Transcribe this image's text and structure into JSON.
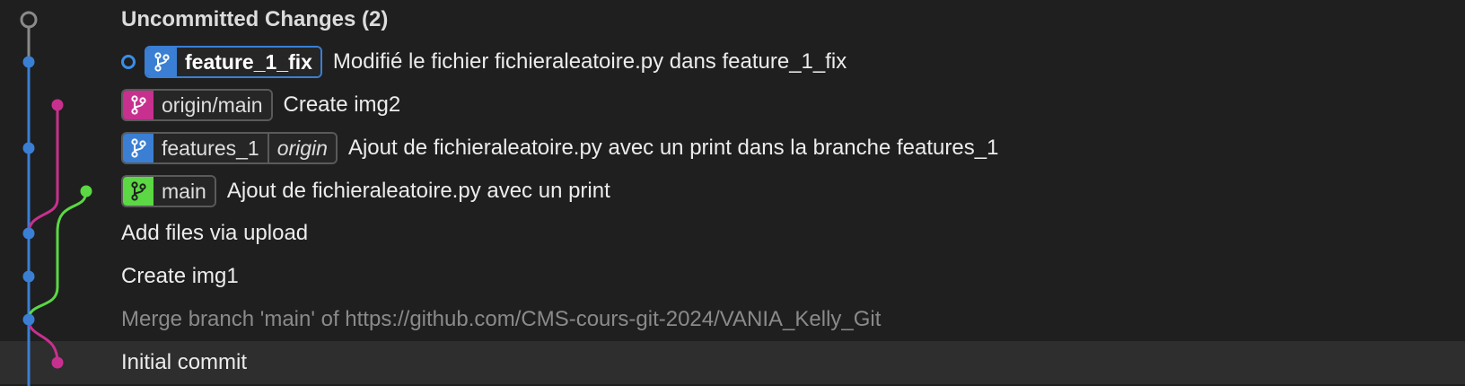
{
  "colors": {
    "blue": "#3a7fd4",
    "magenta": "#c8308f",
    "green": "#5bd843",
    "gray": "#8a8a8a"
  },
  "rows": {
    "uncommitted": {
      "message": "Uncommitted Changes (2)"
    },
    "feature_1_fix": {
      "branch": "feature_1_fix",
      "branch_icon": "git-branch-icon",
      "message": "Modifié le fichier fichieraleatoire.py dans feature_1_fix"
    },
    "origin_main": {
      "branch": "origin/main",
      "branch_icon": "git-branch-icon",
      "message": "Create img2"
    },
    "features_1": {
      "branch": "features_1",
      "remote": "origin",
      "branch_icon": "git-branch-icon",
      "message": "Ajout de fichieraleatoire.py avec un print dans la branche features_1"
    },
    "main": {
      "branch": "main",
      "branch_icon": "git-branch-icon",
      "message": "Ajout de fichieraleatoire.py avec un print"
    },
    "add_files": {
      "message": "Add files via upload"
    },
    "create_img1": {
      "message": "Create img1"
    },
    "merge": {
      "message": "Merge branch 'main' of https://github.com/CMS-cours-git-2024/VANIA_Kelly_Git"
    },
    "initial": {
      "message": "Initial commit"
    }
  }
}
